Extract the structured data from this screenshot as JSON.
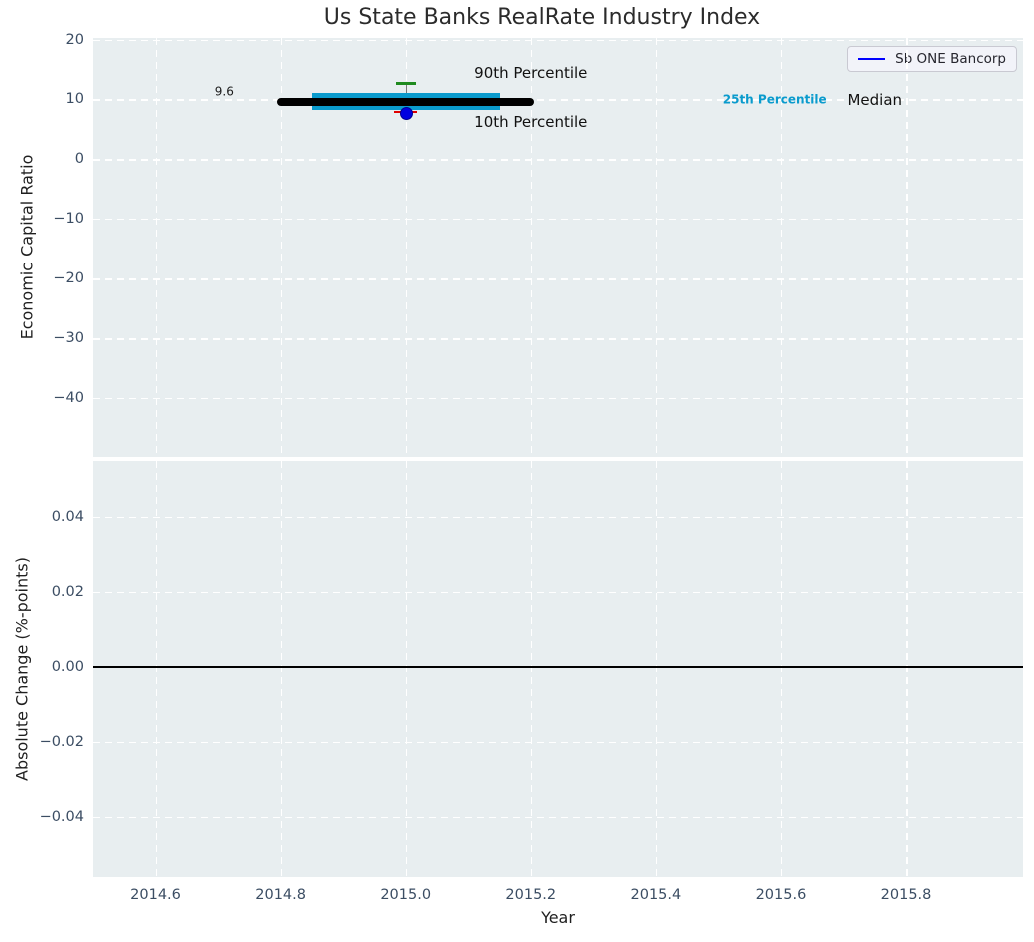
{
  "title": "Us State Banks RealRate Industry Index",
  "legend": {
    "label": "Sb ONE Bancorp",
    "line_color": "#0000ff"
  },
  "x_axis": {
    "label": "Year",
    "xlim": [
      2014.5,
      2015.987
    ],
    "ticks": [
      {
        "v": 2014.6,
        "label": "2014.6"
      },
      {
        "v": 2014.8,
        "label": "2014.8"
      },
      {
        "v": 2015.0,
        "label": "2015.0"
      },
      {
        "v": 2015.2,
        "label": "2015.2"
      },
      {
        "v": 2015.4,
        "label": "2015.4"
      },
      {
        "v": 2015.6,
        "label": "2015.6"
      },
      {
        "v": 2015.8,
        "label": "2015.8"
      }
    ]
  },
  "top_plot": {
    "ylabel": "Economic Capital Ratio",
    "ylim": [
      -49.95,
      20.31
    ],
    "yticks": [
      {
        "v": 20,
        "label": "20"
      },
      {
        "v": 10,
        "label": "10"
      },
      {
        "v": 0,
        "label": "0"
      },
      {
        "v": -10,
        "label": "−10"
      },
      {
        "v": -20,
        "label": "−20"
      },
      {
        "v": -30,
        "label": "−30"
      },
      {
        "v": -40,
        "label": "−40"
      }
    ]
  },
  "bottom_plot": {
    "ylabel": "Absolute Change (%-points)",
    "ylim": [
      -0.056,
      0.0549
    ],
    "yticks": [
      {
        "v": 0.04,
        "label": "0.04"
      },
      {
        "v": 0.02,
        "label": "0.02"
      },
      {
        "v": 0.0,
        "label": "0.00"
      },
      {
        "v": -0.02,
        "label": "−0.02"
      },
      {
        "v": -0.04,
        "label": "−0.04"
      }
    ]
  },
  "chart_data": [
    {
      "type": "boxplot",
      "title": "Us State Banks RealRate Industry Index",
      "xlabel": "Year",
      "ylabel": "Economic Capital Ratio",
      "xlim": [
        2014.5,
        2015.987
      ],
      "ylim": [
        -49.95,
        20.31
      ],
      "x": 2015.0,
      "median": 9.6,
      "median_label": "9.6",
      "median_span": [
        2014.795,
        2015.205
      ],
      "q1": 8.2,
      "q3": 11.1,
      "box_span": [
        2014.85,
        2015.15
      ],
      "p90": 12.7,
      "p10": 7.9,
      "tick_half_width": 0.016,
      "company_point": {
        "name": "Sb ONE Bancorp",
        "x": 2015.0,
        "y": 7.9
      },
      "colors": {
        "box": "#0a9bcd",
        "median": "#000000",
        "p90_tick": "#1f8a1f",
        "p10_tick": "#e00000",
        "company_point": "#0000e0",
        "whisker": "#777777"
      },
      "annotations": [
        {
          "text": "9.6",
          "x": 2014.71,
          "y": 11.2,
          "size": 12,
          "color": "#1a1a1a",
          "weight": "400"
        },
        {
          "text": "90th Percentile",
          "x": 2015.2,
          "y": 14.4,
          "size": 15,
          "color": "#111111",
          "weight": "400"
        },
        {
          "text": "10th Percentile",
          "x": 2015.2,
          "y": 6.2,
          "size": 15,
          "color": "#111111",
          "weight": "400"
        },
        {
          "text": "25th Percentile",
          "x": 2015.59,
          "y": 9.9,
          "size": 12,
          "color": "#0a9bcd",
          "weight": "700"
        },
        {
          "text": "Median",
          "x": 2015.75,
          "y": 9.9,
          "size": 15,
          "color": "#111111",
          "weight": "400"
        }
      ],
      "grid": true,
      "legend_position": "upper right"
    },
    {
      "type": "line",
      "xlabel": "Year",
      "ylabel": "Absolute Change (%-points)",
      "xlim": [
        2014.5,
        2015.987
      ],
      "ylim": [
        -0.056,
        0.0549
      ],
      "zero_line": 0.0,
      "grid": true
    }
  ]
}
